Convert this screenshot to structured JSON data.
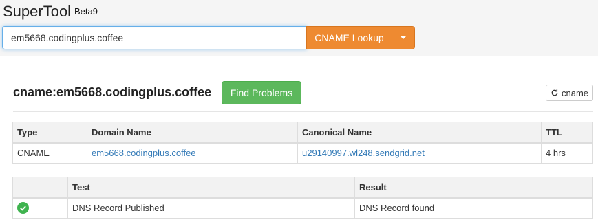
{
  "header": {
    "app_name": "SuperTool",
    "badge": "Beta9"
  },
  "search": {
    "value": "em5668.codingplus.coffee",
    "button_label": "CNAME Lookup"
  },
  "result": {
    "heading": "cname:em5668.codingplus.coffee",
    "find_problems_label": "Find Problems",
    "refresh_label": "cname"
  },
  "records_table": {
    "headers": [
      "Type",
      "Domain Name",
      "Canonical Name",
      "TTL"
    ],
    "rows": [
      [
        "CNAME",
        "em5668.codingplus.coffee",
        "u29140997.wl248.sendgrid.net",
        "4 hrs"
      ]
    ]
  },
  "tests_table": {
    "headers": [
      "",
      "Test",
      "Result"
    ],
    "rows": [
      {
        "status": "check-circle-icon",
        "test": "DNS Record Published",
        "result": "DNS Record found"
      }
    ]
  },
  "colors": {
    "accent": "#ee8a31",
    "success": "#5cb85c",
    "link": "#337ab7"
  }
}
